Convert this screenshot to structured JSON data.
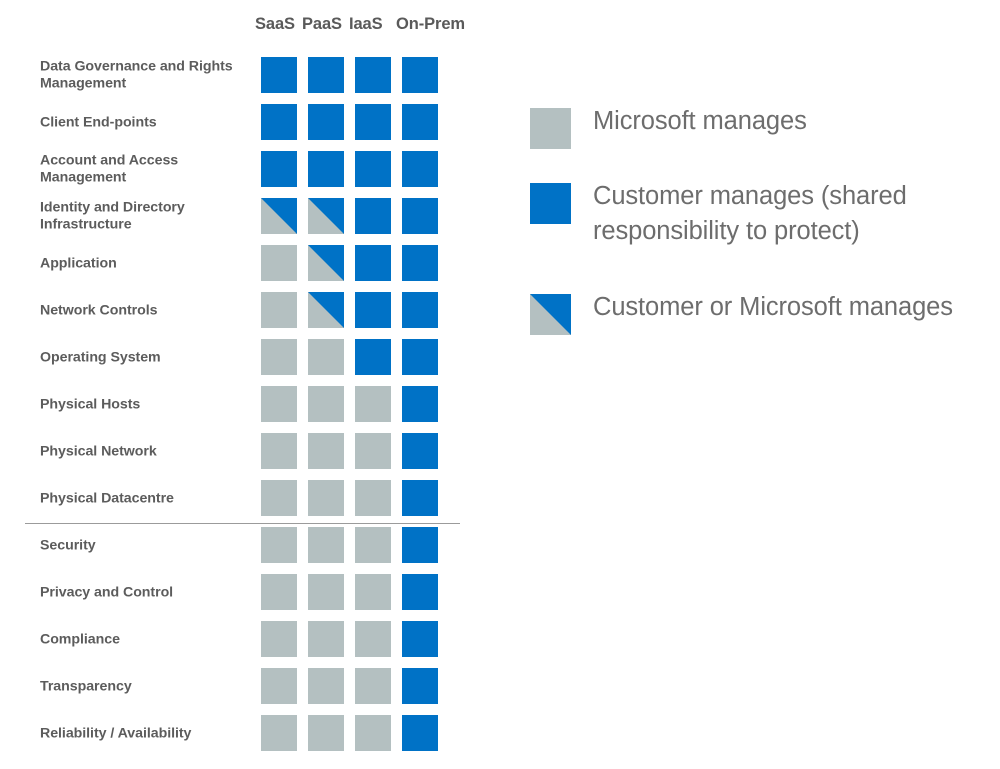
{
  "matrix": {
    "columns": [
      "SaaS",
      "PaaS",
      "IaaS",
      "On-Prem"
    ],
    "rows": [
      {
        "label": "Data Governance and Rights Management",
        "values": [
          "customer",
          "customer",
          "customer",
          "customer"
        ]
      },
      {
        "label": "Client End-points",
        "values": [
          "customer",
          "customer",
          "customer",
          "customer"
        ]
      },
      {
        "label": "Account and Access Management",
        "values": [
          "customer",
          "customer",
          "customer",
          "customer"
        ]
      },
      {
        "label": "Identity and Directory Infrastructure",
        "values": [
          "split",
          "split",
          "customer",
          "customer"
        ]
      },
      {
        "label": "Application",
        "values": [
          "microsoft",
          "split",
          "customer",
          "customer"
        ]
      },
      {
        "label": "Network Controls",
        "values": [
          "microsoft",
          "split",
          "customer",
          "customer"
        ]
      },
      {
        "label": "Operating System",
        "values": [
          "microsoft",
          "microsoft",
          "customer",
          "customer"
        ]
      },
      {
        "label": "Physical Hosts",
        "values": [
          "microsoft",
          "microsoft",
          "microsoft",
          "customer"
        ]
      },
      {
        "label": "Physical Network",
        "values": [
          "microsoft",
          "microsoft",
          "microsoft",
          "customer"
        ]
      },
      {
        "label": "Physical Datacentre",
        "values": [
          "microsoft",
          "microsoft",
          "microsoft",
          "customer"
        ]
      },
      {
        "label": "Security",
        "values": [
          "microsoft",
          "microsoft",
          "microsoft",
          "customer"
        ]
      },
      {
        "label": "Privacy and Control",
        "values": [
          "microsoft",
          "microsoft",
          "microsoft",
          "customer"
        ]
      },
      {
        "label": "Compliance",
        "values": [
          "microsoft",
          "microsoft",
          "microsoft",
          "customer"
        ]
      },
      {
        "label": "Transparency",
        "values": [
          "microsoft",
          "microsoft",
          "microsoft",
          "customer"
        ]
      },
      {
        "label": "Reliability / Availability",
        "values": [
          "microsoft",
          "microsoft",
          "microsoft",
          "customer"
        ]
      }
    ],
    "divider_after_row_index": 9
  },
  "legend": {
    "items": [
      {
        "swatch": "microsoft",
        "label": "Microsoft manages"
      },
      {
        "swatch": "customer",
        "label": "Customer manages (shared\nresponsibility to protect)"
      },
      {
        "swatch": "split",
        "label": "Customer or Microsoft manages"
      }
    ]
  },
  "colors": {
    "customer_blue": "#0072c6",
    "microsoft_gray": "#b4c0c1",
    "row_label_text": "#5c5c5c",
    "legend_text": "#6d6d6d",
    "divider": "#9b9b9b",
    "background": "#ffffff"
  }
}
